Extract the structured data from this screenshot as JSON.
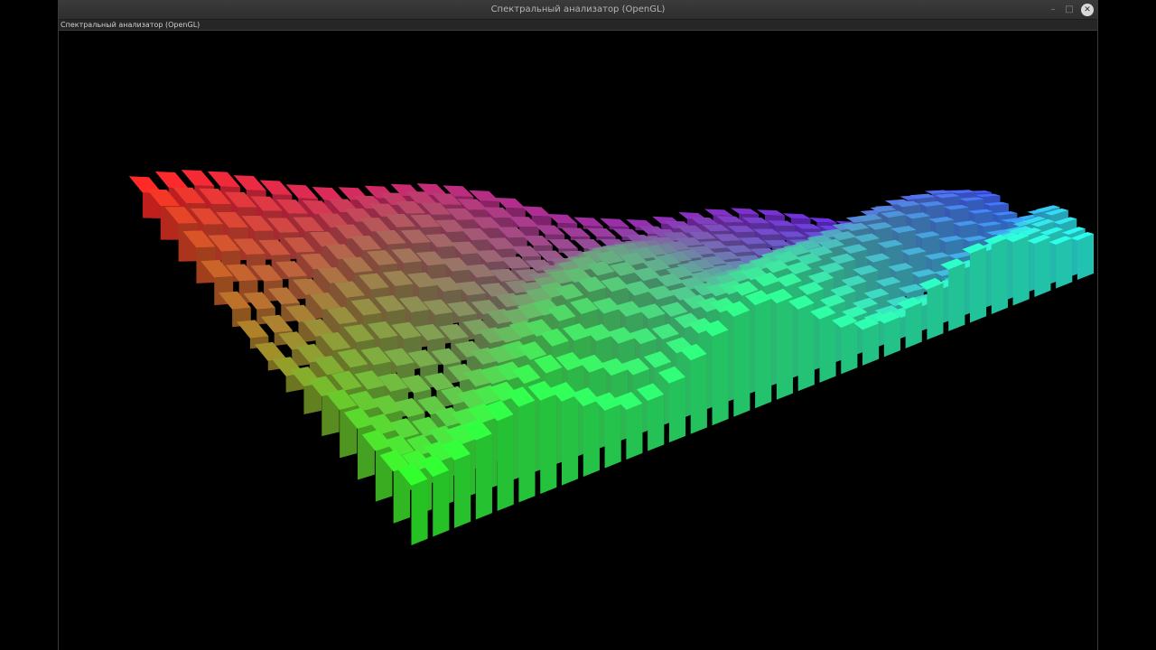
{
  "window": {
    "title": "Спектральный анализатор (OpenGL)",
    "subtitle": "Спектральный анализатор (OpenGL)",
    "controls": {
      "minimize": "–",
      "maximize": "□",
      "close": "✕"
    }
  },
  "viewport": {
    "background": "#000000",
    "grid_columns": 32,
    "grid_rows": 16,
    "color_corners": {
      "back_left": "#ff2020",
      "back_right": "#4a2aff",
      "front_left": "#2aff2a",
      "front_right": "#2affe6"
    }
  }
}
